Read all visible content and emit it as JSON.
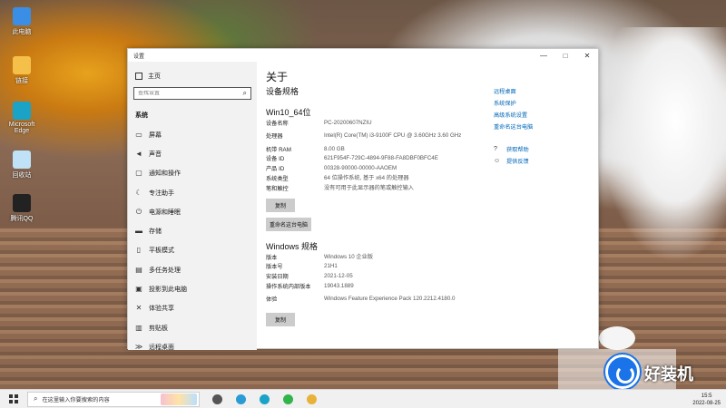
{
  "desktop": {
    "icons": [
      {
        "label": "此电脑",
        "icon": "computer-icon",
        "color": "#3a8ee6"
      },
      {
        "label": "链接",
        "icon": "link-folder-icon",
        "color": "#f4c04a"
      },
      {
        "label": "Microsoft Edge",
        "icon": "edge-icon",
        "color": "#1aa3c6"
      },
      {
        "label": "回收站",
        "icon": "recycle-bin-icon",
        "color": "#bfe2f7"
      },
      {
        "label": "腾讯QQ",
        "icon": "qq-icon",
        "color": "#222222"
      }
    ]
  },
  "window": {
    "title": "设置",
    "controls": {
      "minimize": "—",
      "maximize": "□",
      "close": "✕"
    }
  },
  "sidebar": {
    "home": "主页",
    "search_placeholder": "查找设置",
    "section": "系统",
    "items": [
      {
        "label": "屏幕",
        "icon": "display-icon",
        "glyph": "▭"
      },
      {
        "label": "声音",
        "icon": "sound-icon",
        "glyph": "◄"
      },
      {
        "label": "通知和操作",
        "icon": "notifications-icon",
        "glyph": "▢"
      },
      {
        "label": "专注助手",
        "icon": "focus-assist-icon",
        "glyph": "☾"
      },
      {
        "label": "电源和睡眠",
        "icon": "power-icon",
        "glyph": "⏻"
      },
      {
        "label": "存储",
        "icon": "storage-icon",
        "glyph": "▬"
      },
      {
        "label": "平板模式",
        "icon": "tablet-mode-icon",
        "glyph": "▯"
      },
      {
        "label": "多任务处理",
        "icon": "multitasking-icon",
        "glyph": "▤"
      },
      {
        "label": "投影到此电脑",
        "icon": "projecting-icon",
        "glyph": "▣"
      },
      {
        "label": "体验共享",
        "icon": "shared-experience-icon",
        "glyph": "✕"
      },
      {
        "label": "剪贴板",
        "icon": "clipboard-icon",
        "glyph": "▥"
      },
      {
        "label": "远程桌面",
        "icon": "remote-desktop-icon",
        "glyph": "≫"
      }
    ]
  },
  "main": {
    "title": "关于",
    "device_spec_heading": "设备规格",
    "device_name_title": "Win10_64位",
    "device_specs": [
      {
        "key": "设备名称",
        "value": "PC-20200607NZIU"
      },
      {
        "key": "处理器",
        "value": "Intel(R) Core(TM) i3-9100F CPU @ 3.60GHz 3.60 GHz"
      },
      {
        "key": "机带 RAM",
        "value": "8.00 GB"
      },
      {
        "key": "设备 ID",
        "value": "621F954F-729C-4894-9F88-FA8DBF0BFC4E"
      },
      {
        "key": "产品 ID",
        "value": "00328-90000-00000-AAOEM"
      },
      {
        "key": "系统类型",
        "value": "64 位操作系统, 基于 x64 的处理器"
      },
      {
        "key": "笔和触控",
        "value": "没有可用于此显示器的笔或触控输入"
      }
    ],
    "copy_button": "复制",
    "rename_button": "重命名这台电脑",
    "windows_spec_heading": "Windows 规格",
    "windows_specs": [
      {
        "key": "版本",
        "value": "Windows 10 企业版"
      },
      {
        "key": "版本号",
        "value": "21H1"
      },
      {
        "key": "安装日期",
        "value": "2021-12-05"
      },
      {
        "key": "操作系统内部版本",
        "value": "19043.1889"
      },
      {
        "key": "体验",
        "value": "Windows Feature Experience Pack 120.2212.4180.0"
      }
    ],
    "copy_button_2": "复制"
  },
  "related": {
    "links": [
      "远程桌面",
      "系统保护",
      "高级系统设置",
      "重命名这台电脑"
    ],
    "help": [
      {
        "label": "获取帮助",
        "icon": "help-icon",
        "glyph": "?"
      },
      {
        "label": "提供反馈",
        "icon": "feedback-icon",
        "glyph": "☺"
      }
    ]
  },
  "taskbar": {
    "search_placeholder": "在这里输入你要搜索的内容",
    "apps": [
      {
        "icon": "task-view-icon",
        "color": "#555555"
      },
      {
        "icon": "360-browser-icon",
        "color": "#2b9bd6"
      },
      {
        "icon": "edge-taskbar-icon",
        "color": "#1aa3c6"
      },
      {
        "icon": "wechat-icon",
        "color": "#33b44a"
      },
      {
        "icon": "file-explorer-icon",
        "color": "#e8b23a"
      }
    ],
    "clock_time": "15:5",
    "clock_date": "2022-08-25",
    "accent": "#0067b8"
  },
  "watermark": {
    "text": "好装机"
  }
}
